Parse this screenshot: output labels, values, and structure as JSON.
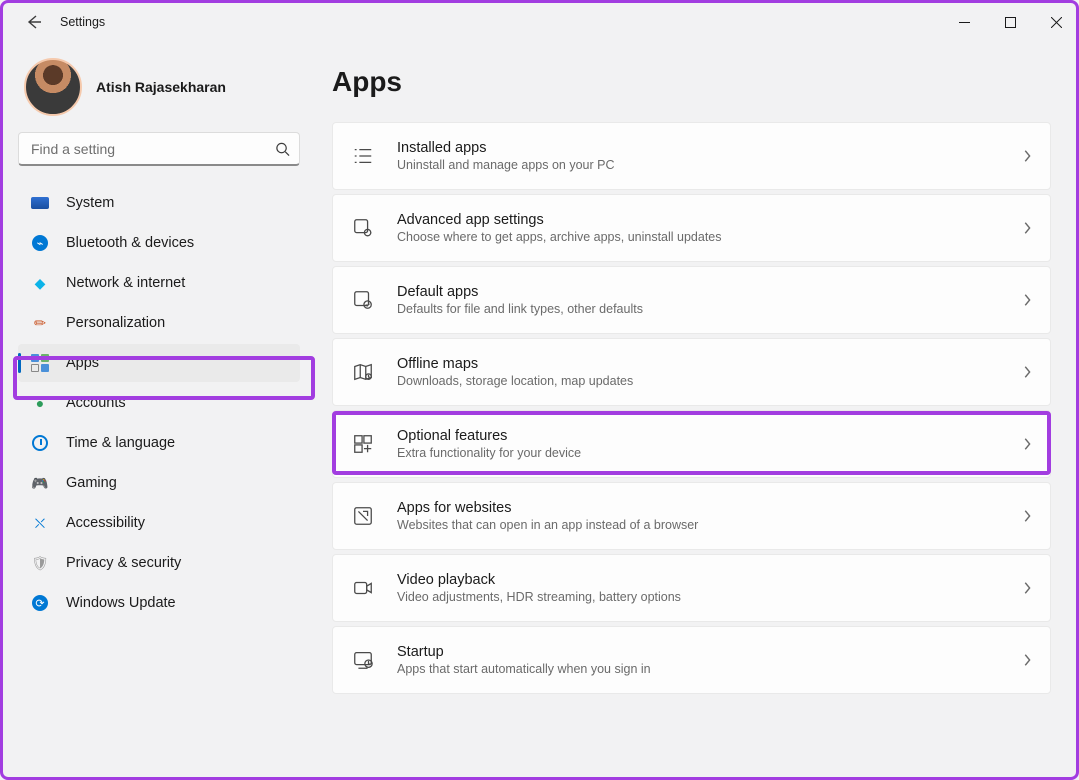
{
  "app": {
    "title": "Settings"
  },
  "user": {
    "name": "Atish Rajasekharan",
    "email": ""
  },
  "search": {
    "placeholder": "Find a setting"
  },
  "nav": {
    "items": [
      {
        "label": "System"
      },
      {
        "label": "Bluetooth & devices"
      },
      {
        "label": "Network & internet"
      },
      {
        "label": "Personalization"
      },
      {
        "label": "Apps"
      },
      {
        "label": "Accounts"
      },
      {
        "label": "Time & language"
      },
      {
        "label": "Gaming"
      },
      {
        "label": "Accessibility"
      },
      {
        "label": "Privacy & security"
      },
      {
        "label": "Windows Update"
      }
    ],
    "active_index": 4
  },
  "page": {
    "heading": "Apps"
  },
  "cards": [
    {
      "title": "Installed apps",
      "sub": "Uninstall and manage apps on your PC"
    },
    {
      "title": "Advanced app settings",
      "sub": "Choose where to get apps, archive apps, uninstall updates"
    },
    {
      "title": "Default apps",
      "sub": "Defaults for file and link types, other defaults"
    },
    {
      "title": "Offline maps",
      "sub": "Downloads, storage location, map updates"
    },
    {
      "title": "Optional features",
      "sub": "Extra functionality for your device"
    },
    {
      "title": "Apps for websites",
      "sub": "Websites that can open in an app instead of a browser"
    },
    {
      "title": "Video playback",
      "sub": "Video adjustments, HDR streaming, battery options"
    },
    {
      "title": "Startup",
      "sub": "Apps that start automatically when you sign in"
    }
  ],
  "highlights": {
    "nav_item_index": 4,
    "card_index": 4
  }
}
